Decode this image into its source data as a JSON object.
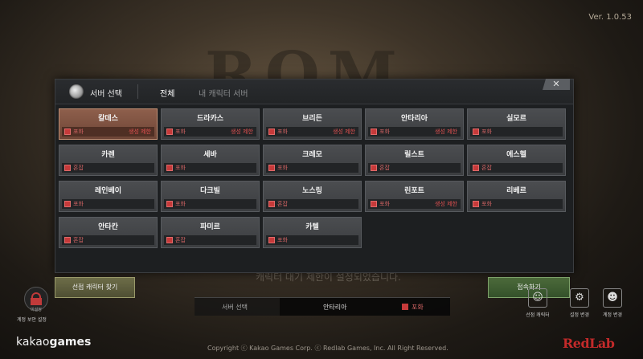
{
  "background": {
    "logo_text": "ROM",
    "subtitle": "캐릭터 대기 제한이 설정되었습니다."
  },
  "version": "Ver. 1.0.53",
  "modal": {
    "title": "서버 선택",
    "tabs": [
      "전체",
      "내 캐릭터 서버"
    ],
    "close_label": "✕"
  },
  "servers": [
    {
      "name": "칼데스",
      "status": "포화",
      "limit": "생성 제한",
      "selected": true
    },
    {
      "name": "드라카스",
      "status": "포화",
      "limit": "생성 제한"
    },
    {
      "name": "브리든",
      "status": "포화",
      "limit": "생성 제한"
    },
    {
      "name": "안타리아",
      "status": "포화",
      "limit": "생성 제한"
    },
    {
      "name": "실모르",
      "status": "포화",
      "limit": ""
    },
    {
      "name": "카렌",
      "status": "혼잡",
      "limit": ""
    },
    {
      "name": "세바",
      "status": "포화",
      "limit": ""
    },
    {
      "name": "크레모",
      "status": "포화",
      "limit": ""
    },
    {
      "name": "릴스트",
      "status": "혼잡",
      "limit": ""
    },
    {
      "name": "에스헬",
      "status": "혼잡",
      "limit": ""
    },
    {
      "name": "레인베이",
      "status": "포화",
      "limit": ""
    },
    {
      "name": "다크빌",
      "status": "포화",
      "limit": ""
    },
    {
      "name": "노스링",
      "status": "혼잡",
      "limit": ""
    },
    {
      "name": "린포트",
      "status": "포화",
      "limit": "생성 제한"
    },
    {
      "name": "리베르",
      "status": "포화",
      "limit": ""
    },
    {
      "name": "안타칸",
      "status": "혼잡",
      "limit": ""
    },
    {
      "name": "파미르",
      "status": "혼잡",
      "limit": ""
    },
    {
      "name": "카텔",
      "status": "포화",
      "limit": ""
    }
  ],
  "buttons": {
    "find_character": "선점 캐릭터 찾기",
    "connect": "접속하기"
  },
  "server_bar": {
    "label": "서버 선택",
    "selected_name": "안타리아",
    "selected_status": "포화"
  },
  "lock": {
    "sub": "미설정",
    "label": "계정 보안 설정"
  },
  "right_icons": [
    {
      "icon": "user-check-icon",
      "label": "선점 캐릭터"
    },
    {
      "icon": "gear-icon",
      "label": "설정 변경"
    },
    {
      "icon": "account-icon",
      "label": "계정 변경"
    }
  ],
  "footer": {
    "brand_prefix": "kakao",
    "brand_suffix": "games",
    "copyright": "Copyright ⓒ Kakao Games Corp. ⓒ Redlab Games, Inc. All Right Reserved.",
    "developer_logo": "RedLab"
  },
  "colors": {
    "selected_card": "#8e5f4c",
    "status_red": "#c63a3a",
    "connect_green": "#4c6a3a"
  }
}
